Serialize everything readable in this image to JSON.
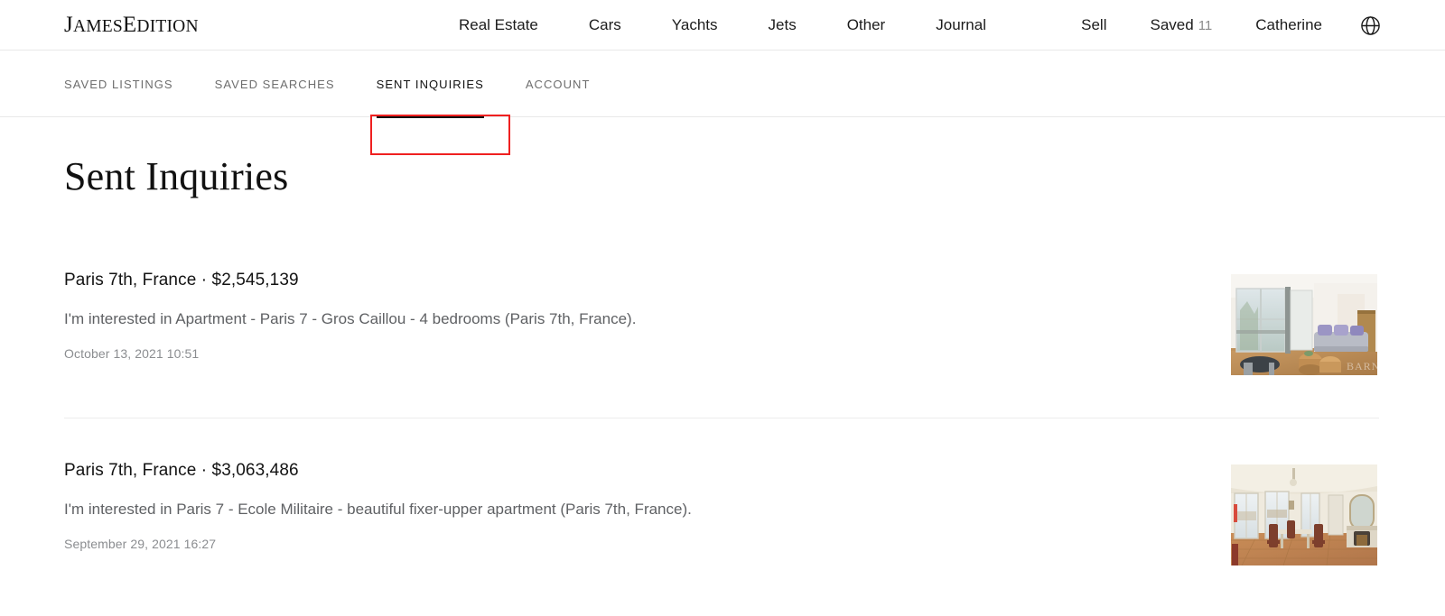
{
  "brand": {
    "logo_main": "J",
    "logo_text_1": "AMES",
    "logo_text_cap2": "E",
    "logo_text_2": "DITION",
    "logo_full": "JamesEdition"
  },
  "header": {
    "nav": [
      {
        "label": "Real Estate",
        "name": "nav-real-estate"
      },
      {
        "label": "Cars",
        "name": "nav-cars"
      },
      {
        "label": "Yachts",
        "name": "nav-yachts"
      },
      {
        "label": "Jets",
        "name": "nav-jets"
      },
      {
        "label": "Other",
        "name": "nav-other"
      },
      {
        "label": "Journal",
        "name": "nav-journal"
      }
    ],
    "sell_label": "Sell",
    "saved_label": "Saved",
    "saved_count": "11",
    "account_name": "Catherine",
    "language_icon": "globe-icon"
  },
  "subnav": {
    "items": [
      {
        "label": "Saved listings",
        "active": false
      },
      {
        "label": "Saved searches",
        "active": false
      },
      {
        "label": "Sent inquiries",
        "active": true
      },
      {
        "label": "Account",
        "active": false
      }
    ],
    "highlight_color": "#ef2020"
  },
  "main": {
    "page_title": "Sent Inquiries",
    "inquiries": [
      {
        "title": "Paris 7th, France · $2,545,139",
        "message": "I'm interested in Apartment - Paris 7 - Gros Caillou - 4 bedrooms (Paris 7th, France).",
        "date": "October 13, 2021 10:51",
        "thumbnail_alt": "Bright Parisian living room with large windows, grey sofa and wooden coffee tables"
      },
      {
        "title": "Paris 7th, France · $3,063,486",
        "message": "I'm interested in Paris 7 - Ecole Militaire - beautiful fixer-upper apartment (Paris 7th, France).",
        "date": "September 29, 2021 16:27",
        "thumbnail_alt": "Classic Haussmannian room with tall windows, parquet floor, dining table and fireplace mirror"
      }
    ]
  },
  "colors": {
    "text_primary": "#131313",
    "text_secondary": "#5f6164",
    "text_muted": "#8b8d90",
    "border": "#e8e8e8",
    "accent_red": "#ef2020"
  }
}
